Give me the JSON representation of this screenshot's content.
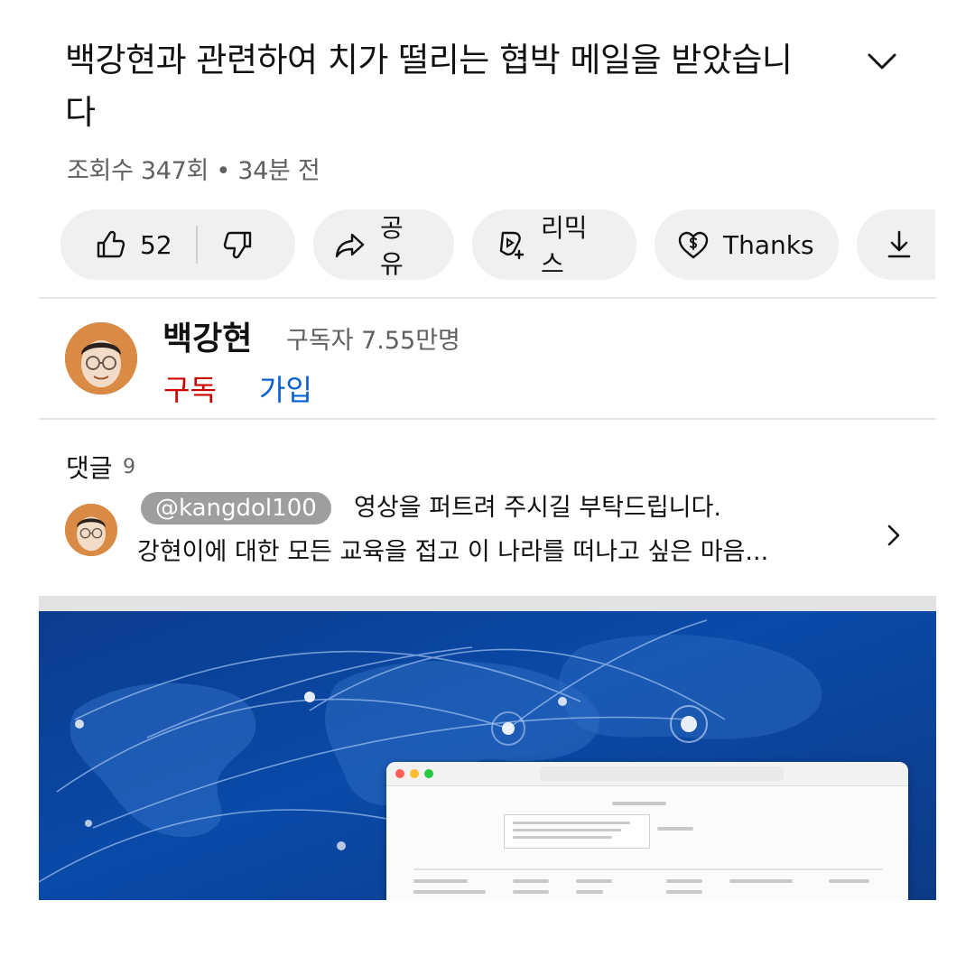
{
  "video": {
    "title": "백강현과 관련하여 치가 떨리는 협박 메일을 받았습니다",
    "meta": "조회수 347회 • 34분 전"
  },
  "actions": {
    "like_count": "52",
    "share_label": "공유",
    "remix_label": "리믹스",
    "thanks_label": "Thanks"
  },
  "channel": {
    "name": "백강현",
    "subscribers": "구독자 7.55만명",
    "subscribe_label": "구독",
    "join_label": "가입"
  },
  "comments": {
    "label": "댓글",
    "count": "9",
    "top_comment": {
      "handle": "@kangdol100",
      "line1": "영상을 퍼트려 주시길 부탁드립니다.",
      "line2": "강현이에 대한 모든 교육을 접고 이 나라를 떠나고 싶은 마음..."
    }
  },
  "icons": {
    "like": "thumbs-up-icon",
    "dislike": "thumbs-down-icon",
    "share": "share-arrow-icon",
    "remix": "remix-icon",
    "thanks": "heart-dollar-icon",
    "download": "download-icon",
    "expand": "chevron-down-icon",
    "comments_open": "chevron-right-icon"
  },
  "colors": {
    "subscribe": "#cc0000",
    "join": "#065fd4",
    "pill_background": "#f0f0f0",
    "thumbnail_background": "#0a4aa8"
  }
}
